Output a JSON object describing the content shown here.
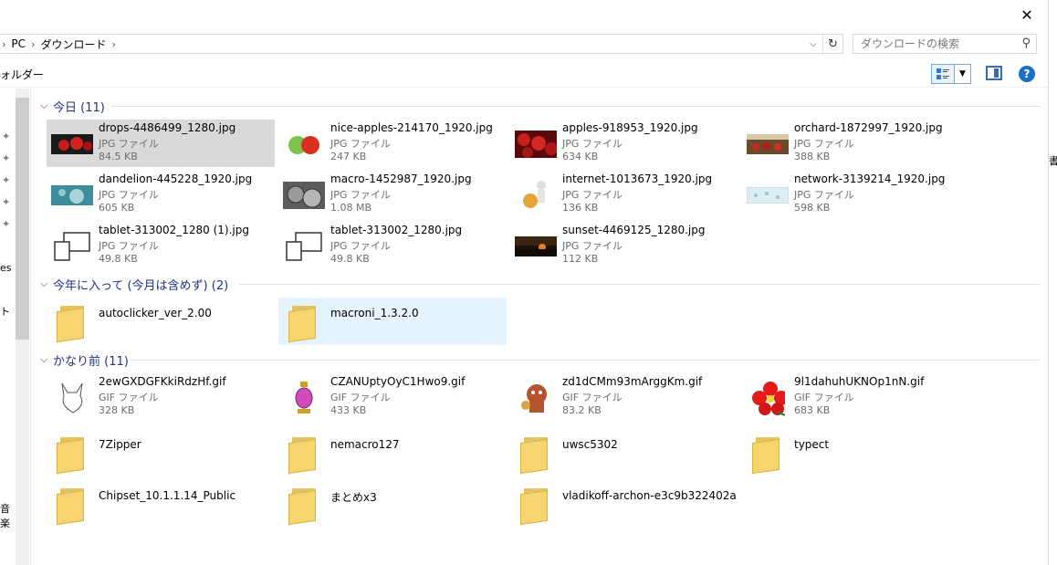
{
  "window": {
    "close_glyph": "✕"
  },
  "address": {
    "crumbs": [
      "PC",
      "ダウンロード"
    ],
    "search_placeholder": "ダウンロードの検索"
  },
  "toolbar": {
    "new_folder_fragment": "ォルダー",
    "help_label": "?"
  },
  "nav_fragments": {
    "f1": "es",
    "f2": "ト",
    "f3": "音楽"
  },
  "right_fragments": {
    "r1": "書"
  },
  "groups": {
    "today": {
      "label": "今日 (11)"
    },
    "this_year": {
      "label": "今年に入って (今月は含めず) (2)"
    },
    "long_ago": {
      "label": "かなり前 (11)"
    }
  },
  "files": {
    "today": [
      {
        "name": "drops-4486499_1280.jpg",
        "type": "JPG ファイル",
        "size": "84.5 KB"
      },
      {
        "name": "nice-apples-214170_1920.jpg",
        "type": "JPG ファイル",
        "size": "247 KB"
      },
      {
        "name": "apples-918953_1920.jpg",
        "type": "JPG ファイル",
        "size": "634 KB"
      },
      {
        "name": "orchard-1872997_1920.jpg",
        "type": "JPG ファイル",
        "size": "388 KB"
      },
      {
        "name": "dandelion-445228_1920.jpg",
        "type": "JPG ファイル",
        "size": "605 KB"
      },
      {
        "name": "macro-1452987_1920.jpg",
        "type": "JPG ファイル",
        "size": "1.08 MB"
      },
      {
        "name": "internet-1013673_1920.jpg",
        "type": "JPG ファイル",
        "size": "136 KB"
      },
      {
        "name": "network-3139214_1920.jpg",
        "type": "JPG ファイル",
        "size": "598 KB"
      },
      {
        "name": "tablet-313002_1280 (1).jpg",
        "type": "JPG ファイル",
        "size": "49.8 KB"
      },
      {
        "name": "tablet-313002_1280.jpg",
        "type": "JPG ファイル",
        "size": "49.8 KB"
      },
      {
        "name": "sunset-4469125_1280.jpg",
        "type": "JPG ファイル",
        "size": "112 KB"
      }
    ],
    "this_year": [
      {
        "name": "autoclicker_ver_2.00"
      },
      {
        "name": "macroni_1.3.2.0"
      }
    ],
    "long_ago": [
      {
        "name": "2ewGXDGFKkiRdzHf.gif",
        "type": "GIF ファイル",
        "size": "328 KB"
      },
      {
        "name": "CZANUptyOyC1Hwo9.gif",
        "type": "GIF ファイル",
        "size": "433 KB"
      },
      {
        "name": "zd1dCMm93mArggKm.gif",
        "type": "GIF ファイル",
        "size": "83.2 KB"
      },
      {
        "name": "9l1dahuhUKNOp1nN.gif",
        "type": "GIF ファイル",
        "size": "683 KB"
      },
      {
        "name": "7Zipper"
      },
      {
        "name": "nemacro127"
      },
      {
        "name": "uwsc5302"
      },
      {
        "name": "typect"
      },
      {
        "name": "Chipset_10.1.1.14_Public"
      },
      {
        "name": "まとめx3"
      },
      {
        "name": "vladikoff-archon-e3c9b322402a"
      }
    ]
  },
  "colors": {
    "group_header": "#1e3287",
    "selected_bg": "#d9d9d9",
    "hover_bg": "#e5f3ff",
    "accent": "#1a6fc9"
  }
}
